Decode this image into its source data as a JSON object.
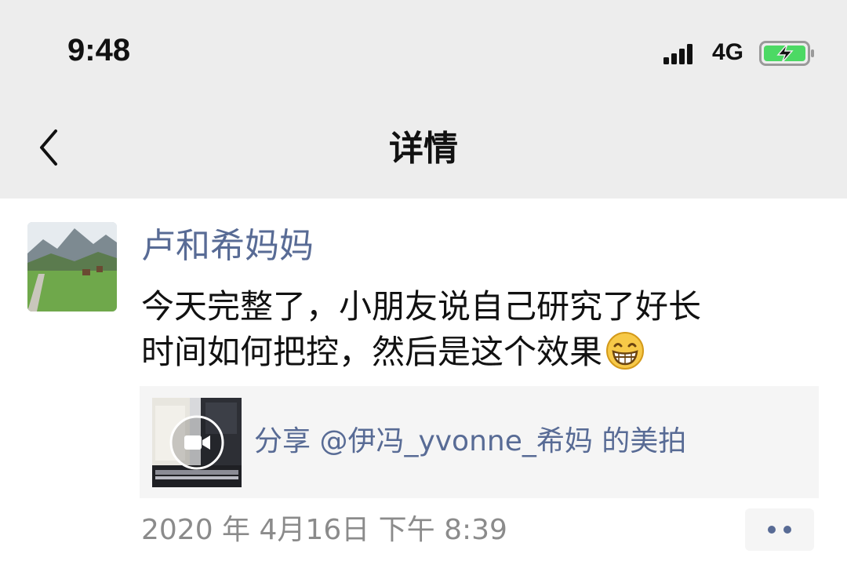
{
  "status_bar": {
    "time": "9:48",
    "network": "4G",
    "battery_charging": true,
    "battery_color": "#4cd964"
  },
  "nav": {
    "title": "详情",
    "back_icon": "chevron-left-icon"
  },
  "post": {
    "author": "卢和希妈妈",
    "content_line1": "今天完整了，小朋友说自己研究了好长",
    "content_line2": "时间如何把控，然后是这个效果",
    "emoji": "grinning-face-icon",
    "share": {
      "text": "分享 @伊冯_yvonne_希妈 的美拍",
      "thumb_icon": "video-camera-icon"
    },
    "timestamp": "2020 年 4月16日 下午 8:39"
  },
  "colors": {
    "link": "#586b95",
    "topbar_bg": "#ededed",
    "share_bg": "#f5f5f5"
  }
}
